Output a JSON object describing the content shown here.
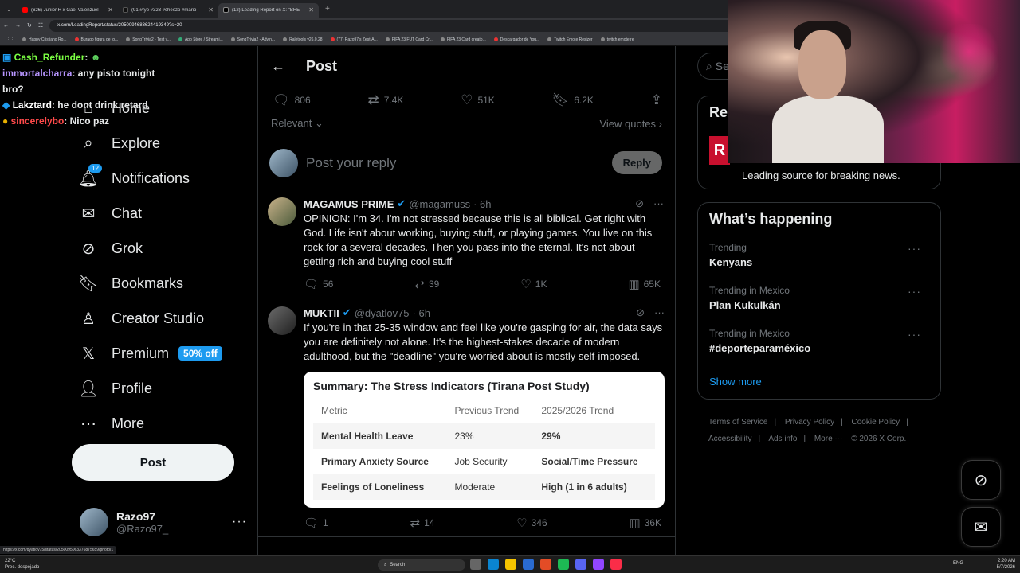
{
  "browser": {
    "tabs": [
      {
        "label": "(626) Junior H x Gael Valenzuel",
        "color": "#ff0000",
        "active": false
      },
      {
        "label": "(91)#fyp #323 #cheezo #mario",
        "color": "#222",
        "active": false
      },
      {
        "label": "(12) Leading Report on X: \"BRE",
        "color": "#000",
        "active": true
      }
    ],
    "url": "x.com/LeadingReport/status/2050094683624419349?s=20",
    "bookmarks": [
      "Happy Cristiano Ro...",
      "Burago figura de to...",
      "SongTrivia2 - Test y...",
      "App Store / Streami...",
      "SongTrivia2 - Advin...",
      "Raletools v26.0.28",
      "(77) Razo97's Zest-A...",
      "FIFA 23 FUT Card Cr...",
      "FIFA 23 Card creato...",
      "Descargador de You...",
      "Twitch Emote Resizer",
      "twitch emote re"
    ]
  },
  "chat": [
    {
      "user": "Cash_Refunder",
      "text": ":",
      "color": "#7bff42"
    },
    {
      "user": "immortalcharra",
      "text": ": any pisto tonight bro?",
      "color": "#b795ff"
    },
    {
      "user": "Lakztard",
      "text": ": he dont drink retard",
      "color": "#ffffff"
    },
    {
      "user": "sincerelybo",
      "text": ": Nico paz",
      "color": "#ff4a4a"
    }
  ],
  "nav": {
    "items": [
      {
        "label": "Home",
        "icon": "⌂"
      },
      {
        "label": "Explore",
        "icon": "⌕"
      },
      {
        "label": "Notifications",
        "icon": "🔔︎"
      },
      {
        "label": "Chat",
        "icon": "✉"
      },
      {
        "label": "Grok",
        "icon": "⊘"
      },
      {
        "label": "Bookmarks",
        "icon": "🔖︎"
      },
      {
        "label": "Creator Studio",
        "icon": "♙"
      },
      {
        "label": "Premium",
        "icon": "𝕏"
      },
      {
        "label": "Profile",
        "icon": "👤︎"
      },
      {
        "label": "More",
        "icon": "⋯"
      }
    ],
    "notif_count": "12",
    "premium_badge": "50% off",
    "post_label": "Post"
  },
  "account": {
    "name": "Razo97",
    "handle": "@Razo97_"
  },
  "main": {
    "title": "Post",
    "stats": {
      "replies": "806",
      "reposts": "7.4K",
      "likes": "51K",
      "bookmarks": "6.2K"
    },
    "sort": "Relevant",
    "view_quotes": "View quotes",
    "reply_placeholder": "Post your reply",
    "reply_button": "Reply"
  },
  "tweets": [
    {
      "name": "MAGAMUS PRIME",
      "handle": "@magamuss",
      "time": "· 6h",
      "text": "OPINION: I'm 34. I'm not stressed because this is all biblical. Get right with God. Life isn't about working, buying stuff, or playing games. You live on this rock for a several decades. Then you pass into the eternal. It's not about getting rich and buying cool stuff",
      "replies": "56",
      "reposts": "39",
      "likes": "1K",
      "views": "65K"
    },
    {
      "name": "MUKTII",
      "handle": "@dyatlov75",
      "time": "· 6h",
      "text": "If you're in that 25-35 window and feel like you're gasping for air, the data says you are definitely not alone. It's the highest-stakes decade of modern adulthood, but the \"deadline\" you're worried about is mostly self-imposed.",
      "replies": "1",
      "reposts": "14",
      "likes": "346",
      "views": "36K",
      "card": {
        "title": "Summary: The Stress Indicators (Tirana Post Study)",
        "headers": [
          "Metric",
          "Previous Trend",
          "2025/2026 Trend"
        ],
        "rows": [
          [
            "Mental Health Leave",
            "23%",
            "29%"
          ],
          [
            "Primary Anxiety Source",
            "Job Security",
            "Social/Time Pressure"
          ],
          [
            "Feelings of Loneliness",
            "Moderate",
            "High (1 in 6 adults)"
          ]
        ]
      }
    }
  ],
  "sidebar": {
    "search_placeholder": "Se",
    "relevant_title": "Rel",
    "relevant_logo": "R",
    "relevant_bio": "Leading source for breaking news.",
    "happening_title": "What’s happening",
    "trends": [
      {
        "context": "Trending",
        "title": "Kenyans"
      },
      {
        "context": "Trending in Mexico",
        "title": "Plan Kukulkán"
      },
      {
        "context": "Trending in Mexico",
        "title": "#deporteparaméxico"
      }
    ],
    "show_more": "Show more",
    "footer": [
      "Terms of Service",
      "|",
      "Privacy Policy",
      "|",
      "Cookie Policy",
      "|",
      "Accessibility",
      "|",
      "Ads info",
      "|",
      "More ···",
      "© 2026 X Corp."
    ]
  },
  "taskbar": {
    "weather_temp": "22°C",
    "weather_desc": "Prec. despejado",
    "search": "Search",
    "lang": "ENG",
    "time": "2:20 AM",
    "date": "5/7/2026"
  },
  "status_url": "https://x.com/dyatlov75/status/2050095063376875659/photo/1"
}
